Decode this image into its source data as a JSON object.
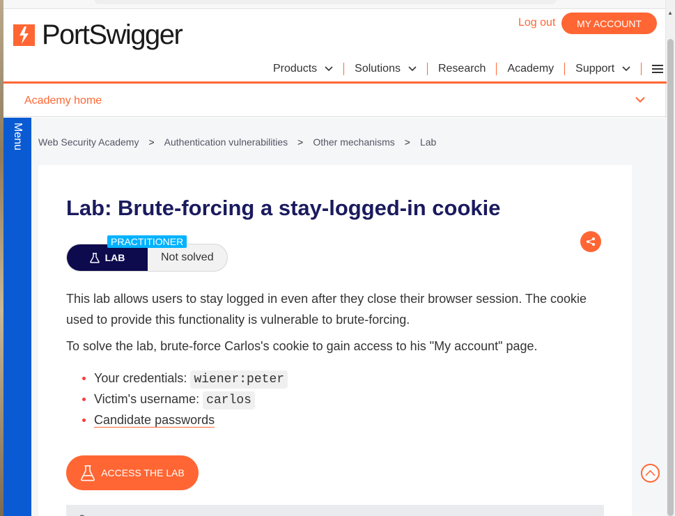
{
  "header": {
    "brand": "PortSwigger",
    "logout_label": "Log out",
    "account_label": "MY ACCOUNT"
  },
  "nav": {
    "items": [
      {
        "label": "Products",
        "has_dropdown": true
      },
      {
        "label": "Solutions",
        "has_dropdown": true
      },
      {
        "label": "Research",
        "has_dropdown": false
      },
      {
        "label": "Academy",
        "has_dropdown": false
      },
      {
        "label": "Support",
        "has_dropdown": true
      }
    ],
    "menu_icon": "hamburger-icon"
  },
  "subnav": {
    "home_label": "Academy home",
    "toggle_icon": "chevron-down-icon"
  },
  "side_menu": {
    "label": "Menu"
  },
  "breadcrumb": {
    "items": [
      "Web Security Academy",
      "Authentication vulnerabilities",
      "Other mechanisms",
      "Lab"
    ],
    "separator": ">"
  },
  "lab": {
    "title": "Lab: Brute-forcing a stay-logged-in cookie",
    "level": "PRACTITIONER",
    "type_label": "LAB",
    "status": "Not solved",
    "description": "This lab allows users to stay logged in even after they close their browser session. The cookie used to provide this functionality is vulnerable to brute-forcing.",
    "goal": "To solve the lab, brute-force Carlos's cookie to gain access to his \"My account\" page.",
    "credentials_label": "Your credentials:",
    "credentials_value": "wiener:peter",
    "victim_label": "Victim's username:",
    "victim_value": "carlos",
    "candidate_link": "Candidate passwords",
    "access_button": "ACCESS THE LAB"
  },
  "colors": {
    "accent": "#ff6633",
    "title": "#1a1a5e",
    "side_menu": "#0a5bd3",
    "lab_badge": "#0d0a4e",
    "level_tag": "#00b2ff"
  },
  "icons": {
    "share": "share-icon",
    "flask": "flask-icon",
    "back_to_top": "arrow-up-icon"
  }
}
